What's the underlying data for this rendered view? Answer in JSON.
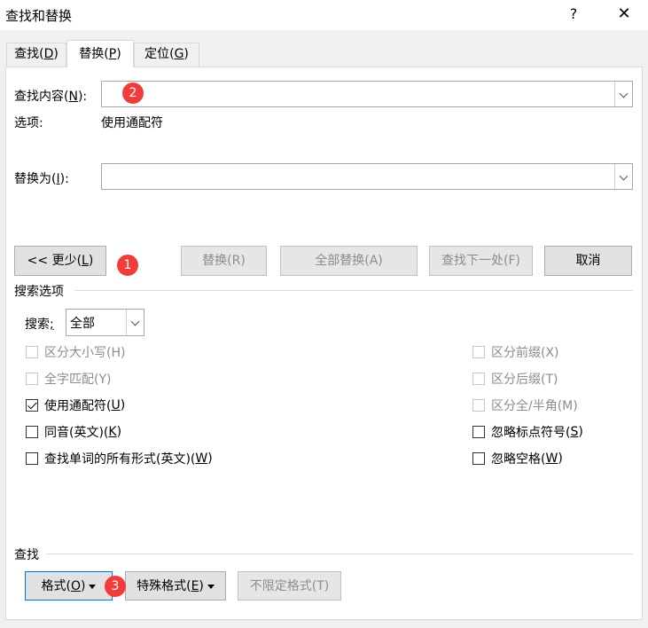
{
  "window": {
    "title": "查找和替换",
    "help": "?",
    "close": "✕"
  },
  "tabs": [
    {
      "pre": "查找(",
      "key": "D",
      "post": ")"
    },
    {
      "pre": "替换(",
      "key": "P",
      "post": ")"
    },
    {
      "pre": "定位(",
      "key": "G",
      "post": ")"
    }
  ],
  "find": {
    "label_pre": "查找内容(",
    "label_key": "N",
    "label_post": "):",
    "value": ""
  },
  "options": {
    "label": "选项:",
    "value": "使用通配符"
  },
  "replace": {
    "label_pre": "替换为(",
    "label_key": "I",
    "label_post": "):",
    "value": ""
  },
  "buttons": {
    "less_pre": "<< 更少(",
    "less_key": "L",
    "less_post": ")",
    "replace": "替换(R)",
    "replace_all": "全部替换(A)",
    "find_next": "查找下一处(F)",
    "cancel": "取消"
  },
  "search_options": {
    "title": "搜索选项",
    "search_label_pre": "搜索",
    "search_label_key": ";",
    "search_value": "全部"
  },
  "checkboxes_left": [
    {
      "text": "区分大小写(H)",
      "key": "",
      "post": "",
      "checked": false,
      "disabled": true
    },
    {
      "text": "全字匹配(Y)",
      "key": "",
      "post": "",
      "checked": false,
      "disabled": true
    },
    {
      "text": "使用通配符(",
      "key": "U",
      "post": ")",
      "checked": true,
      "disabled": false
    },
    {
      "text": "同音(英文)(",
      "key": "K",
      "post": ")",
      "checked": false,
      "disabled": false
    },
    {
      "text": "查找单词的所有形式(英文)(",
      "key": "W",
      "post": ")",
      "checked": false,
      "disabled": false
    }
  ],
  "checkboxes_right": [
    {
      "text": "区分前缀(X)",
      "key": "",
      "post": "",
      "checked": false,
      "disabled": true
    },
    {
      "text": "区分后缀(T)",
      "key": "",
      "post": "",
      "checked": false,
      "disabled": true
    },
    {
      "text": "区分全/半角(M)",
      "key": "",
      "post": "",
      "checked": false,
      "disabled": true
    },
    {
      "text": "忽略标点符号(",
      "key": "S",
      "post": ")",
      "checked": false,
      "disabled": false
    },
    {
      "text": "忽略空格(",
      "key": "W",
      "post": ")",
      "checked": false,
      "disabled": false
    }
  ],
  "find_section": {
    "title": "查找",
    "format_pre": "格式(",
    "format_key": "O",
    "format_post": ")",
    "special_pre": "特殊格式(",
    "special_key": "E",
    "special_post": ")",
    "no_format": "不限定格式(T)"
  },
  "badges": [
    "1",
    "2",
    "3"
  ],
  "colors": {
    "badge": "#f23b3b",
    "focus": "#0078d7",
    "disabled_text": "#8c8c8c"
  }
}
